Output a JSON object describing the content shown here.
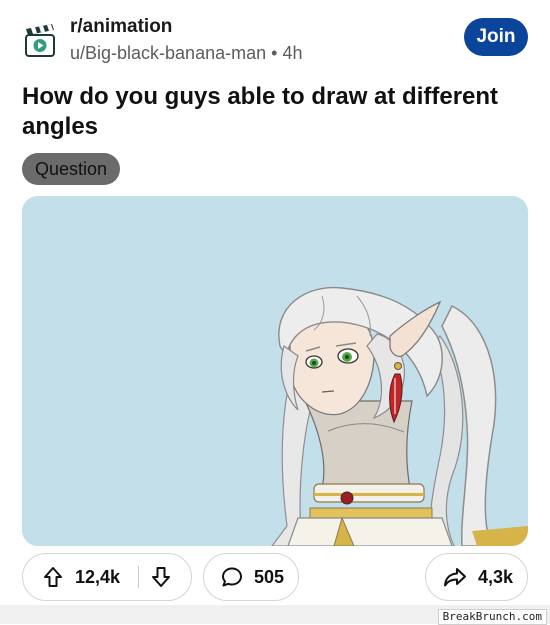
{
  "post": {
    "subreddit": "r/animation",
    "author": "u/Big-black-banana-man",
    "separator": "•",
    "time": "4h",
    "join_label": "Join",
    "title": "How do you guys able to draw at different angles",
    "flair": "Question"
  },
  "actions": {
    "upvotes": "12,4k",
    "comments": "505",
    "shares": "4,3k"
  },
  "watermark": "BreakBrunch.com",
  "colors": {
    "join_button": "#0a449b",
    "flair_bg": "#6b6b6b",
    "image_bg": "#c3dfe9"
  },
  "icons": {
    "subreddit": "clapperboard-play-icon",
    "upvote": "arrow-up-icon",
    "downvote": "arrow-down-icon",
    "comment": "speech-bubble-icon",
    "share": "share-arrow-icon"
  }
}
